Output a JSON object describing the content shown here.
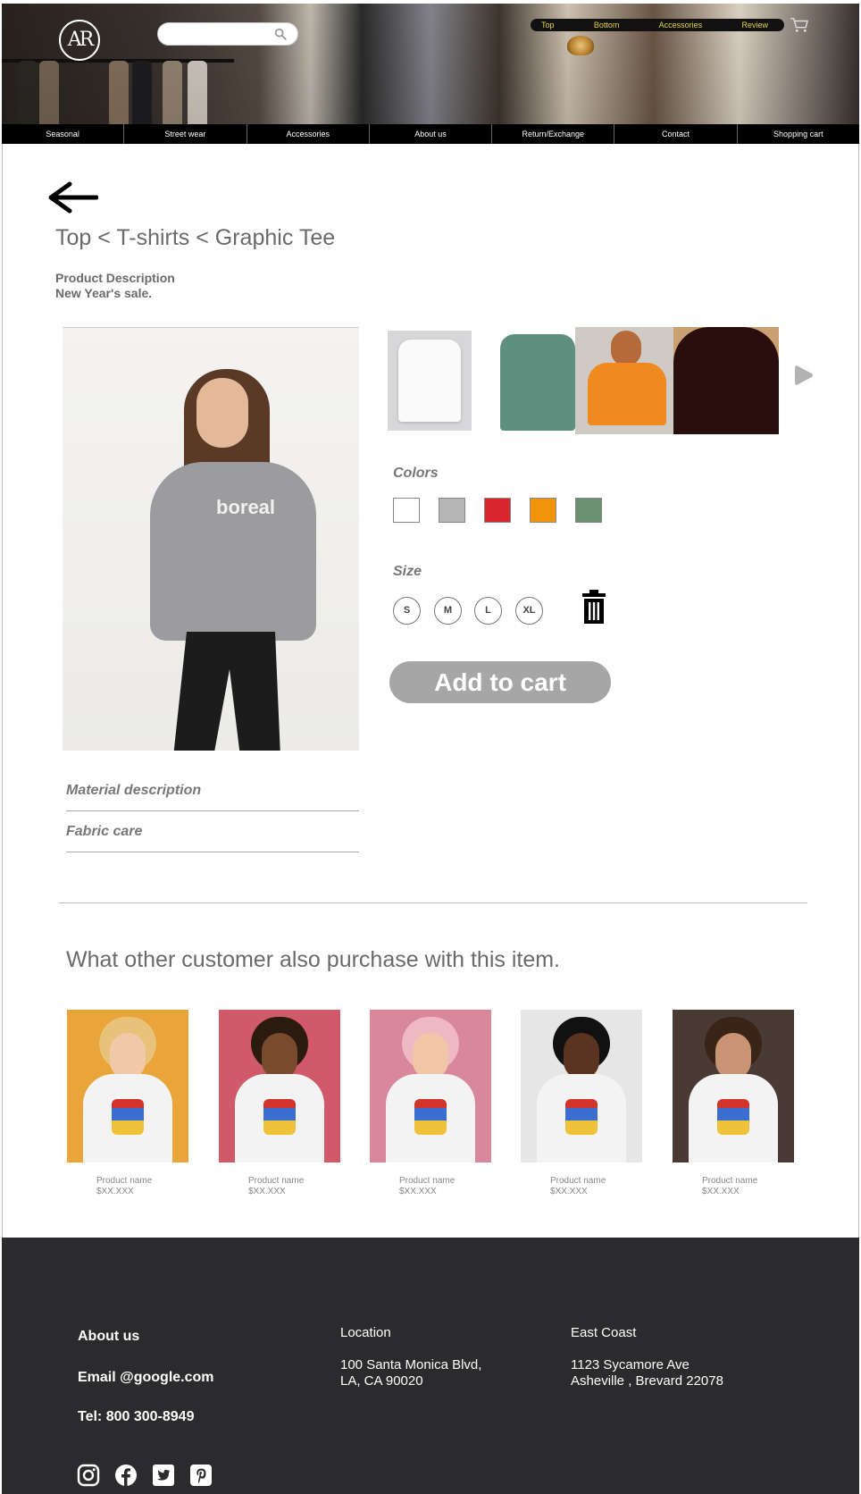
{
  "header": {
    "logo_text": "AR",
    "search_placeholder": "",
    "top_nav": [
      "Top",
      "Bottom",
      "Accessories",
      "Review"
    ],
    "main_nav": [
      "Seasonal",
      "Street wear",
      "Accessories",
      "About us",
      "Return/Exchange",
      "Contact",
      "Shopping cart"
    ]
  },
  "product": {
    "breadcrumb": "Top < T-shirts < Graphic Tee",
    "description_title": "Product Description",
    "description_text": "New Year's sale.",
    "photo_shirt_text": "boreal",
    "material_label": "Material description",
    "fabric_label": "Fabric care",
    "colors_label": "Colors",
    "colors": [
      "#ffffff",
      "#b5b5b5",
      "#d8262c",
      "#f2930c",
      "#6a8f72"
    ],
    "size_label": "Size",
    "sizes": [
      "S",
      "M",
      "L",
      "XL"
    ],
    "add_to_cart": "Add to cart"
  },
  "recommendations": {
    "title": "What other customer also purchase with this item.",
    "items": [
      {
        "name": "Product name",
        "price": "$XX.XXX",
        "bg": "#e9a43a"
      },
      {
        "name": "Product name",
        "price": "$XX.XXX",
        "bg": "#d05a6a"
      },
      {
        "name": "Product name",
        "price": "$XX.XXX",
        "bg": "#d8889a"
      },
      {
        "name": "Product name",
        "price": "$XX.XXX",
        "bg": "#e6e6e6"
      },
      {
        "name": "Product name",
        "price": "$XX.XXX",
        "bg": "#4a3a34"
      }
    ]
  },
  "footer": {
    "about": "About us",
    "email": "Email @google.com",
    "tel": "Tel: 800 300-8949",
    "location_title": "Location",
    "location_line1": "100 Santa Monica Blvd,",
    "location_line2": "LA, CA 90020",
    "east_title": "East Coast",
    "east_line1": "1123 Sycamore Ave",
    "east_line2": "Asheville , Brevard 22078",
    "social_icons": [
      "instagram-icon",
      "facebook-icon",
      "twitter-icon",
      "pinterest-icon"
    ]
  }
}
